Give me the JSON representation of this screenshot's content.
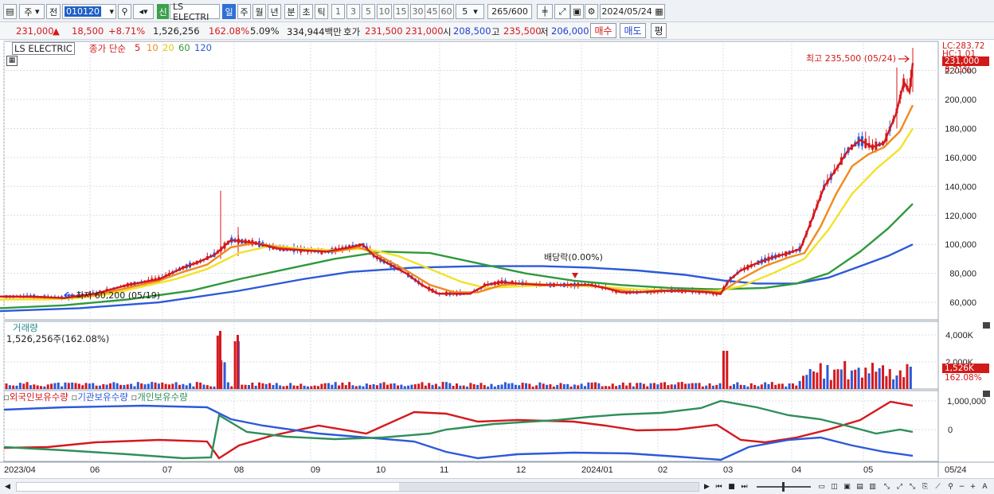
{
  "toolbar": {
    "market": "주",
    "prev_label": "전",
    "code": "010120",
    "stock_name": "LS ELECTRI",
    "new_label": "신",
    "periods": [
      "일",
      "주",
      "월",
      "년",
      "분",
      "초",
      "틱"
    ],
    "selected_period": "일",
    "intervals": [
      "1",
      "3",
      "5",
      "10",
      "15",
      "30",
      "45",
      "60"
    ],
    "interval_value": "5",
    "count": "265",
    "count_max": "/600",
    "date": "2024/05/24"
  },
  "price": {
    "current": "231,000",
    "change": "18,500",
    "change_pct": "+8.71%",
    "volume": "1,526,256",
    "volume_ratio": "162.08%",
    "turnover_ratio": "5.09%",
    "amount": "334,944백만",
    "bid_label": "호가",
    "bid": "231,500",
    "ask": "231,000",
    "open_label": "시",
    "open": "208,500",
    "high_label": "고",
    "high": "235,500",
    "low_label": "저",
    "low": "206,000",
    "buy_label": "매수",
    "sell_label": "매도",
    "eval_label": "평"
  },
  "main_panel": {
    "title": "LS ELECTRIC",
    "indicator_label": "종가 단순",
    "ma_periods": [
      "5",
      "10",
      "20",
      "60",
      "120"
    ],
    "ma_colors": [
      "#d4191e",
      "#f08a1c",
      "#f2e22a",
      "#2f9a3c",
      "#2d59d9"
    ],
    "high_annotation": "최고 235,500 (05/24)",
    "low_annotation": "최저 60,200 (05/19)",
    "dividend_annotation": "배당락(0.00%)",
    "lc_label": "LC:283.72",
    "hc_label": "HC:1.01",
    "current_price_tag": "231,000",
    "change_tag": "8.71%"
  },
  "volume_panel": {
    "title": "거래량",
    "value": "1,526,256주(162.08%)",
    "current_tag": "1,526K",
    "ratio_tag": "162.08%"
  },
  "holding_panel": {
    "foreign_label": "외국인보유수량",
    "institution_label": "기관보유수량",
    "individual_label": "개인보유수량",
    "foreign_color": "#d4191e",
    "institution_color": "#2d59d9",
    "individual_color": "#2f8f5a"
  },
  "chart_data": [
    {
      "type": "candlestick",
      "title": "LS ELECTRIC",
      "x_ticks": [
        "2023/04",
        "06",
        "07",
        "08",
        "09",
        "10",
        "11",
        "12",
        "2024/01",
        "02",
        "03",
        "04",
        "05",
        "05/24"
      ],
      "y_ticks": [
        60000,
        80000,
        100000,
        120000,
        140000,
        160000,
        180000,
        200000,
        220000
      ],
      "y_tick_labels": [
        "60,000",
        "80,000",
        "100,000",
        "120,000",
        "140,000",
        "160,000",
        "180,000",
        "200,000",
        "220,000"
      ],
      "ylim": [
        48000,
        240000
      ],
      "grid": true,
      "series": [
        {
          "name": "5",
          "color": "#d4191e",
          "points": [
            [
              0,
              64000
            ],
            [
              40,
              64000
            ],
            [
              80,
              63000
            ],
            [
              120,
              66000
            ],
            [
              160,
              72000
            ],
            [
              200,
              76000
            ],
            [
              230,
              84000
            ],
            [
              250,
              88000
            ],
            [
              270,
              93000
            ],
            [
              290,
              103000
            ],
            [
              320,
              101000
            ],
            [
              350,
              97000
            ],
            [
              380,
              96000
            ],
            [
              410,
              95000
            ],
            [
              440,
              98000
            ],
            [
              455,
              100000
            ],
            [
              470,
              92000
            ],
            [
              490,
              86000
            ],
            [
              510,
              80000
            ],
            [
              530,
              72000
            ],
            [
              550,
              66000
            ],
            [
              570,
              66000
            ],
            [
              590,
              66000
            ],
            [
              610,
              72000
            ],
            [
              630,
              74000
            ],
            [
              650,
              73000
            ],
            [
              680,
              72000
            ],
            [
              710,
              72000
            ],
            [
              740,
              72000
            ],
            [
              760,
              70000
            ],
            [
              780,
              67000
            ],
            [
              800,
              67000
            ],
            [
              830,
              68000
            ],
            [
              860,
              68000
            ],
            [
              890,
              67000
            ],
            [
              905,
              66000
            ],
            [
              915,
              75000
            ],
            [
              930,
              82000
            ],
            [
              950,
              87000
            ],
            [
              970,
              91000
            ],
            [
              990,
              94000
            ],
            [
              1005,
              97000
            ],
            [
              1020,
              118000
            ],
            [
              1035,
              140000
            ],
            [
              1050,
              152000
            ],
            [
              1065,
              165000
            ],
            [
              1080,
              172000
            ],
            [
              1095,
              167000
            ],
            [
              1110,
              170000
            ],
            [
              1125,
              190000
            ],
            [
              1135,
              212000
            ],
            [
              1142,
              205000
            ],
            [
              1146,
              225000
            ]
          ]
        },
        {
          "name": "10",
          "color": "#f08a1c",
          "points": [
            [
              0,
              64000
            ],
            [
              40,
              63500
            ],
            [
              80,
              63000
            ],
            [
              120,
              65000
            ],
            [
              160,
              70000
            ],
            [
              200,
              75000
            ],
            [
              230,
              81000
            ],
            [
              260,
              86000
            ],
            [
              290,
              98000
            ],
            [
              320,
              101000
            ],
            [
              350,
              98000
            ],
            [
              380,
              96000
            ],
            [
              420,
              95000
            ],
            [
              450,
              98000
            ],
            [
              470,
              94000
            ],
            [
              490,
              88000
            ],
            [
              510,
              82000
            ],
            [
              540,
              72000
            ],
            [
              570,
              67000
            ],
            [
              600,
              67000
            ],
            [
              630,
              72000
            ],
            [
              660,
              73000
            ],
            [
              700,
              72000
            ],
            [
              740,
              72000
            ],
            [
              770,
              69000
            ],
            [
              800,
              67000
            ],
            [
              840,
              68000
            ],
            [
              880,
              68000
            ],
            [
              905,
              67000
            ],
            [
              930,
              76000
            ],
            [
              960,
              85000
            ],
            [
              990,
              91000
            ],
            [
              1010,
              94000
            ],
            [
              1030,
              112000
            ],
            [
              1050,
              135000
            ],
            [
              1070,
              154000
            ],
            [
              1090,
              162000
            ],
            [
              1110,
              167000
            ],
            [
              1130,
              178000
            ],
            [
              1146,
              196000
            ]
          ]
        },
        {
          "name": "20",
          "color": "#f2e22a",
          "points": [
            [
              0,
              62000
            ],
            [
              60,
              62000
            ],
            [
              100,
              63000
            ],
            [
              140,
              66000
            ],
            [
              180,
              71000
            ],
            [
              220,
              76000
            ],
            [
              260,
              83000
            ],
            [
              300,
              94000
            ],
            [
              340,
              99000
            ],
            [
              380,
              97000
            ],
            [
              420,
              96000
            ],
            [
              460,
              97000
            ],
            [
              500,
              92000
            ],
            [
              540,
              83000
            ],
            [
              580,
              74000
            ],
            [
              610,
              70000
            ],
            [
              650,
              71000
            ],
            [
              700,
              72000
            ],
            [
              750,
              71000
            ],
            [
              800,
              69000
            ],
            [
              850,
              68000
            ],
            [
              900,
              68000
            ],
            [
              930,
              71000
            ],
            [
              970,
              80000
            ],
            [
              1010,
              90000
            ],
            [
              1040,
              110000
            ],
            [
              1070,
              135000
            ],
            [
              1100,
              152000
            ],
            [
              1130,
              166000
            ],
            [
              1146,
              180000
            ]
          ]
        },
        {
          "name": "60",
          "color": "#2f9a3c",
          "points": [
            [
              0,
              56000
            ],
            [
              80,
              58000
            ],
            [
              160,
              62000
            ],
            [
              240,
              68000
            ],
            [
              300,
              76000
            ],
            [
              360,
              83000
            ],
            [
              420,
              90000
            ],
            [
              480,
              95000
            ],
            [
              540,
              94000
            ],
            [
              600,
              87000
            ],
            [
              660,
              80000
            ],
            [
              720,
              75000
            ],
            [
              780,
              72000
            ],
            [
              840,
              70000
            ],
            [
              900,
              69000
            ],
            [
              960,
              70000
            ],
            [
              1000,
              73000
            ],
            [
              1040,
              80000
            ],
            [
              1080,
              95000
            ],
            [
              1115,
              111000
            ],
            [
              1146,
              128000
            ]
          ]
        },
        {
          "name": "120",
          "color": "#2d59d9",
          "points": [
            [
              0,
              54000
            ],
            [
              100,
              56000
            ],
            [
              200,
              60000
            ],
            [
              300,
              68000
            ],
            [
              380,
              76000
            ],
            [
              440,
              81000
            ],
            [
              520,
              84000
            ],
            [
              600,
              85000
            ],
            [
              680,
              85000
            ],
            [
              740,
              84000
            ],
            [
              800,
              82000
            ],
            [
              860,
              79000
            ],
            [
              910,
              75000
            ],
            [
              950,
              73000
            ],
            [
              1000,
              73000
            ],
            [
              1040,
              77000
            ],
            [
              1080,
              85000
            ],
            [
              1115,
              92000
            ],
            [
              1146,
              100000
            ]
          ]
        }
      ]
    },
    {
      "type": "bar",
      "title": "거래량",
      "y_ticks": [
        2000000,
        4000000
      ],
      "y_tick_labels": [
        "2,000K",
        "4,000K"
      ],
      "ylim": [
        0,
        5000000
      ]
    },
    {
      "type": "line",
      "title": "외국인보유수량 / 기관보유수량 / 개인보유수량",
      "y_ticks": [
        1000000,
        0
      ],
      "y_tick_labels": [
        "1,000,000",
        "0"
      ],
      "series": [
        {
          "name": "외국인보유수량",
          "color": "#d4191e"
        },
        {
          "name": "기관보유수량",
          "color": "#2d59d9"
        },
        {
          "name": "개인보유수량",
          "color": "#2f8f5a"
        }
      ]
    }
  ]
}
